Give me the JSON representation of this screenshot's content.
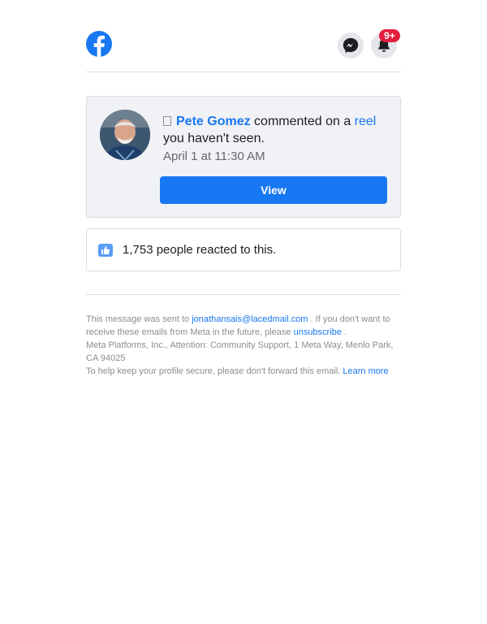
{
  "header": {
    "logo_icon": "facebook-logo",
    "messenger_icon": "messenger-icon",
    "notifications_icon": "bell-icon",
    "notifications_badge": "9+",
    "brand_color": "#1877f2",
    "badge_color": "#e41e3f"
  },
  "notification": {
    "actor": "Pete Gomez",
    "action": " commented on a ",
    "object": "reel",
    "suffix": "you haven't seen.",
    "timestamp": "April 1 at 11:30 AM",
    "button_label": "View"
  },
  "reactions": {
    "icon": "like-icon",
    "text": "1,753 people reacted to this."
  },
  "footer": {
    "line1_prefix": "This message was sent to ",
    "email": "jonathansais@lacedmail.com",
    "line1_suffix": " . If you don't want to receive these emails from Meta in the future, please ",
    "unsubscribe": "unsubscribe",
    "line1_end": " .",
    "address": "Meta Platforms, Inc., Attention: Community Support, 1 Meta Way, Menlo Park, CA 94025",
    "security_text": "To help keep your profile secure, please don't forward this email. ",
    "learn_more": "Learn more"
  }
}
